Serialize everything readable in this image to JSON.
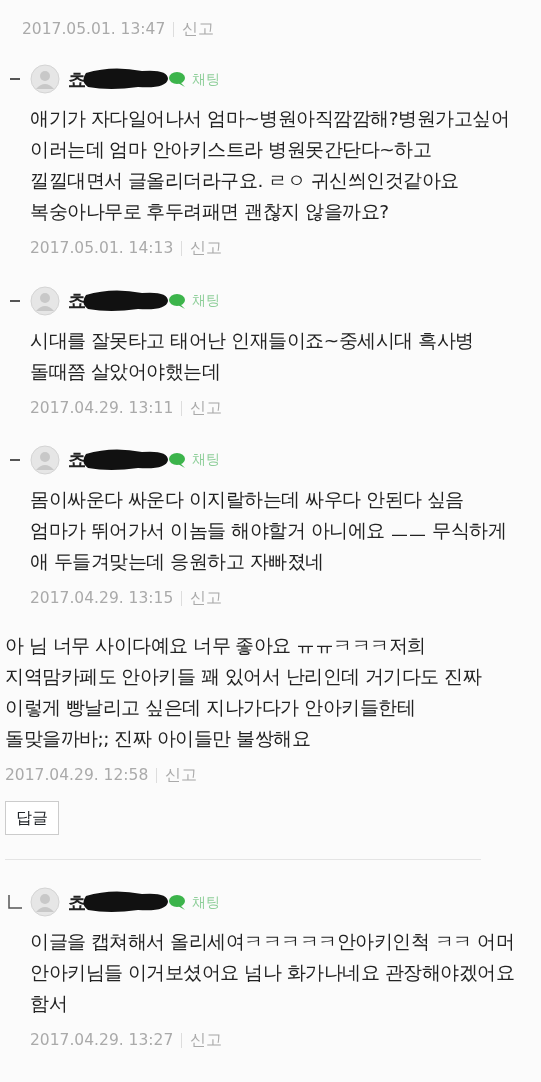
{
  "comments": [
    {
      "kind": "meta_only",
      "time": "2017.05.01. 13:47",
      "report": "신고"
    },
    {
      "kind": "nested",
      "author": "쵸",
      "chat": "채팅",
      "body": "애기가 자다일어나서 엄마~병원아직깜깜해?병원가고싶어 이러는데 엄마 안아키스트라 병원못간단다~하고 낄낄대면서 글올리더라구요. ㄹㅇ 귀신씌인것같아요 복숭아나무로 후두려패면 괜찮지 않을까요?",
      "time": "2017.05.01. 14:13",
      "report": "신고"
    },
    {
      "kind": "nested",
      "author": "쵸",
      "chat": "채팅",
      "body": "시대를 잘못타고 태어난 인재들이죠~중세시대 흑사병 돌때쯤 살았어야했는데",
      "time": "2017.04.29. 13:11",
      "report": "신고"
    },
    {
      "kind": "nested",
      "author": "쵸",
      "chat": "채팅",
      "body": "몸이싸운다 싸운다 이지랄하는데 싸우다 안된다 싶음 엄마가 뛰어가서 이놈들 해야할거 아니에요 ㅡㅡ 무식하게 애 두들겨맞는데 응원하고 자빠졌네",
      "time": "2017.04.29. 13:15",
      "report": "신고"
    },
    {
      "kind": "plain",
      "body": "아 님 너무 사이다예요 너무 좋아요 ㅠㅠㅋㅋㅋ저희 지역맘카페도 안아키들 꽤 있어서 난리인데 거기다도 진짜 이렇게 빵날리고 싶은데 지나가다가 안아키들한테 돌맞을까바;; 진짜 아이들만 불쌍해요",
      "time": "2017.04.29. 12:58",
      "report": "신고",
      "reply_button": "답글"
    },
    {
      "kind": "reply",
      "author": "쵸",
      "chat": "채팅",
      "body": "이글을 캡쳐해서 올리세여ㅋㅋㅋㅋㅋ안아키인척 ㅋㅋ 어머 안아키님들 이거보셨어요 넘나 화가나네요 관장해야겠어요 함서",
      "time": "2017.04.29. 13:27",
      "report": "신고"
    }
  ]
}
